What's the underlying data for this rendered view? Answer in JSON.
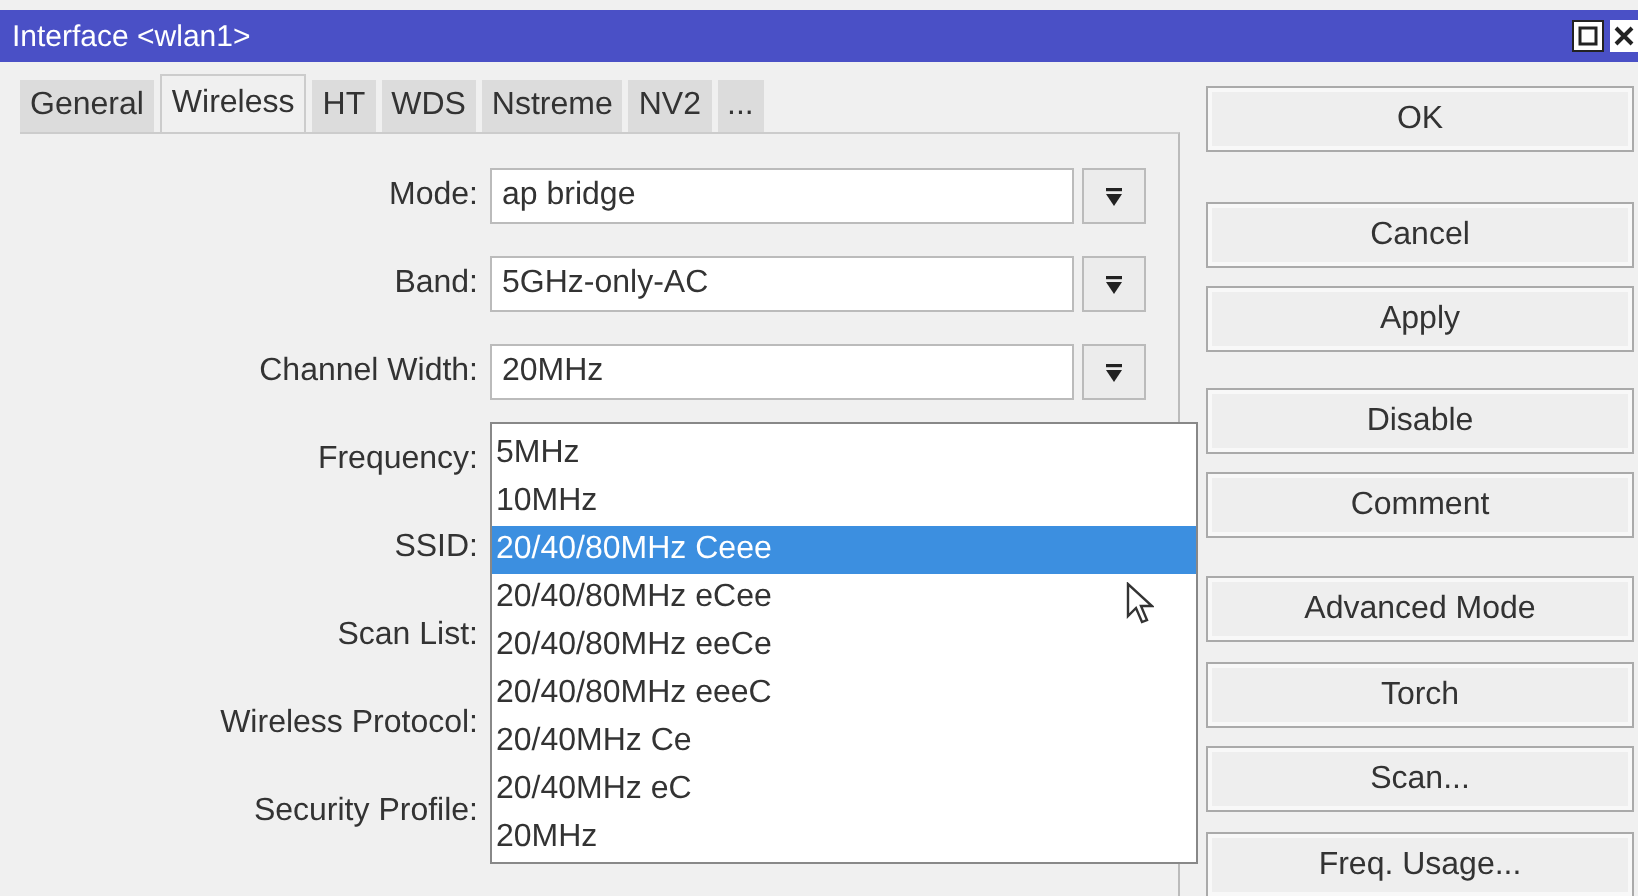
{
  "window": {
    "title": "Interface <wlan1>"
  },
  "tabs": [
    {
      "label": "General",
      "selected": false
    },
    {
      "label": "Wireless",
      "selected": true
    },
    {
      "label": "HT",
      "selected": false
    },
    {
      "label": "WDS",
      "selected": false
    },
    {
      "label": "Nstreme",
      "selected": false
    },
    {
      "label": "NV2",
      "selected": false
    },
    {
      "label": "...",
      "selected": false
    }
  ],
  "fields": [
    {
      "label": "Mode:",
      "value": "ap bridge"
    },
    {
      "label": "Band:",
      "value": "5GHz-only-AC"
    },
    {
      "label": "Channel Width:",
      "value": "20MHz"
    },
    {
      "label": "Frequency:"
    },
    {
      "label": "SSID:"
    },
    {
      "label": "Scan List:"
    },
    {
      "label": "Wireless Protocol:"
    },
    {
      "label": "Security Profile:"
    }
  ],
  "dropdown": {
    "items": [
      {
        "label": "5MHz",
        "selected": false
      },
      {
        "label": "10MHz",
        "selected": false
      },
      {
        "label": "20/40/80MHz Ceee",
        "selected": true
      },
      {
        "label": "20/40/80MHz eCee",
        "selected": false
      },
      {
        "label": "20/40/80MHz eeCe",
        "selected": false
      },
      {
        "label": "20/40/80MHz eeeC",
        "selected": false
      },
      {
        "label": "20/40MHz Ce",
        "selected": false
      },
      {
        "label": "20/40MHz eC",
        "selected": false
      },
      {
        "label": "20MHz",
        "selected": false
      }
    ]
  },
  "buttons": [
    "OK",
    "Cancel",
    "Apply",
    "Disable",
    "Comment",
    "Advanced Mode",
    "Torch",
    "Scan...",
    "Freq. Usage..."
  ]
}
